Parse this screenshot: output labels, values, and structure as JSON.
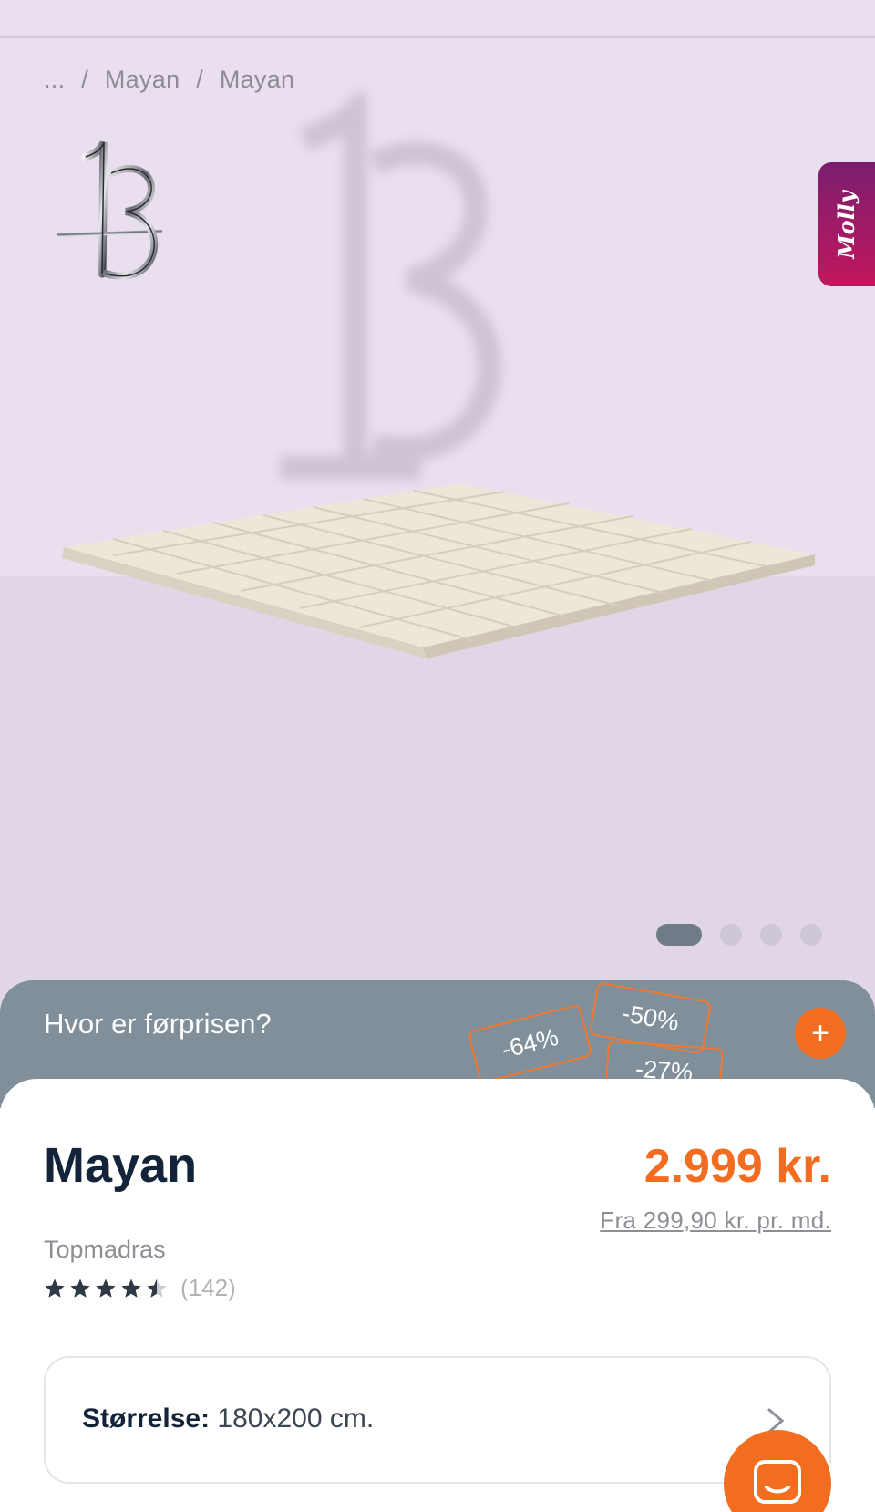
{
  "breadcrumb": {
    "ellipsis": "...",
    "sep1": "/",
    "item1": "Mayan",
    "sep2": "/",
    "item2": "Mayan"
  },
  "side_tab": {
    "label": "Molly"
  },
  "carousel": {
    "slide_count": 4,
    "active_index": 0
  },
  "promo": {
    "question": "Hvor er førprisen?",
    "tags": [
      "-64%",
      "-50%",
      "-27%"
    ]
  },
  "product": {
    "title": "Mayan",
    "price": "2.999 kr.",
    "installment": "Fra 299,90 kr. pr. md.",
    "category": "Topmadras",
    "rating": 4.5,
    "rating_max": 5,
    "review_count": "(142)"
  },
  "size": {
    "label": "Størrelse:",
    "value": "180x200 cm."
  },
  "colors": {
    "accent": "#f36d21",
    "hero_bg": "#e9dfee",
    "promo_bg": "#808f99",
    "title": "#13243a"
  },
  "icons": {
    "plus": "plus-icon",
    "chevron": "chevron-right-icon",
    "chat": "chat-icon"
  }
}
